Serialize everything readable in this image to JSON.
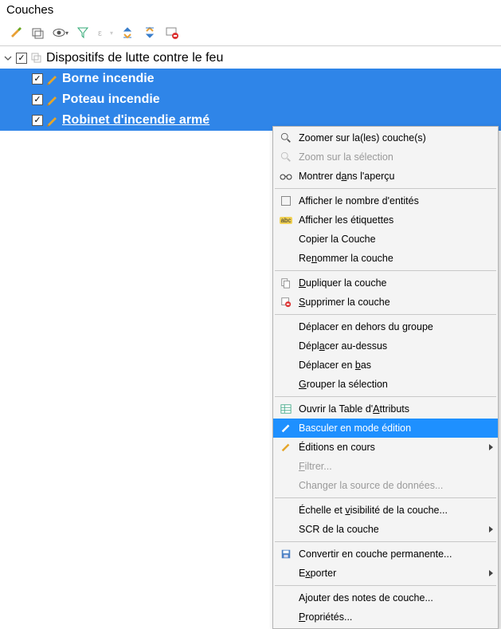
{
  "panel": {
    "title": "Couches"
  },
  "tree": {
    "group": {
      "label": "Dispositifs de lutte contre le feu",
      "checked": true
    },
    "layers": [
      {
        "label": "Borne incendie",
        "checked": true,
        "selected": true,
        "underline": false
      },
      {
        "label": "Poteau incendie",
        "checked": true,
        "selected": true,
        "underline": false
      },
      {
        "label": "Robinet d'incendie armé",
        "checked": true,
        "selected": true,
        "underline": true
      }
    ]
  },
  "menu": {
    "groups": [
      [
        {
          "id": "zoom-layers",
          "label": "Zoomer sur la(les) couche(s)",
          "icon": "magnify",
          "enabled": true
        },
        {
          "id": "zoom-sel",
          "label": "Zoom sur la sélection",
          "icon": "magnify",
          "enabled": false
        },
        {
          "id": "show-overview",
          "label": "Montrer dans l'aperçu",
          "icon": "glasses",
          "enabled": true,
          "underline_char": "a"
        }
      ],
      [
        {
          "id": "feature-count",
          "label": "Afficher le nombre d'entités",
          "icon": "checkbox",
          "enabled": true
        },
        {
          "id": "show-labels",
          "label": "Afficher les étiquettes",
          "icon": "abc",
          "enabled": true
        },
        {
          "id": "copy-layer",
          "label": "Copier la Couche",
          "icon": "",
          "enabled": true
        },
        {
          "id": "rename-layer",
          "label": "Renommer la couche",
          "icon": "",
          "enabled": true,
          "underline_char": "n"
        }
      ],
      [
        {
          "id": "duplicate",
          "label": "Dupliquer la couche",
          "icon": "duplicate",
          "enabled": true,
          "underline_char": "D"
        },
        {
          "id": "remove",
          "label": "Supprimer la couche",
          "icon": "remove",
          "enabled": true,
          "underline_char": "S"
        }
      ],
      [
        {
          "id": "move-out",
          "label": "Déplacer en dehors du groupe",
          "icon": "",
          "enabled": true
        },
        {
          "id": "move-up",
          "label": "Déplacer au-dessus",
          "icon": "",
          "enabled": true,
          "underline_char": "a"
        },
        {
          "id": "move-down",
          "label": "Déplacer en bas",
          "icon": "",
          "enabled": true,
          "underline_char": "b"
        },
        {
          "id": "group-sel",
          "label": "Grouper la sélection",
          "icon": "",
          "enabled": true,
          "underline_char": "G"
        }
      ],
      [
        {
          "id": "open-attr",
          "label": "Ouvrir la Table d'Attributs",
          "icon": "table",
          "enabled": true,
          "underline_char": "A"
        },
        {
          "id": "toggle-edit",
          "label": "Basculer en mode édition",
          "icon": "pencil",
          "enabled": true,
          "highlight": true
        },
        {
          "id": "current-edits",
          "label": "Éditions en cours",
          "icon": "pencil",
          "enabled": true,
          "submenu": true
        },
        {
          "id": "filter",
          "label": "Filtrer...",
          "icon": "",
          "enabled": false,
          "underline_char": "F"
        },
        {
          "id": "change-src",
          "label": "Changer la source de données...",
          "icon": "",
          "enabled": false
        }
      ],
      [
        {
          "id": "scale-vis",
          "label": "Échelle et visibilité de la couche...",
          "icon": "",
          "enabled": true,
          "underline_char": "v"
        },
        {
          "id": "layer-crs",
          "label": "SCR de la couche",
          "icon": "",
          "enabled": true,
          "submenu": true
        }
      ],
      [
        {
          "id": "make-perm",
          "label": "Convertir en couche permanente...",
          "icon": "save",
          "enabled": true
        },
        {
          "id": "export",
          "label": "Exporter",
          "icon": "",
          "enabled": true,
          "submenu": true,
          "underline_char": "x"
        }
      ],
      [
        {
          "id": "layer-notes",
          "label": "Ajouter des notes de couche...",
          "icon": "",
          "enabled": true
        },
        {
          "id": "properties",
          "label": "Propriétés...",
          "icon": "",
          "enabled": true,
          "underline_char": "P"
        }
      ]
    ]
  }
}
